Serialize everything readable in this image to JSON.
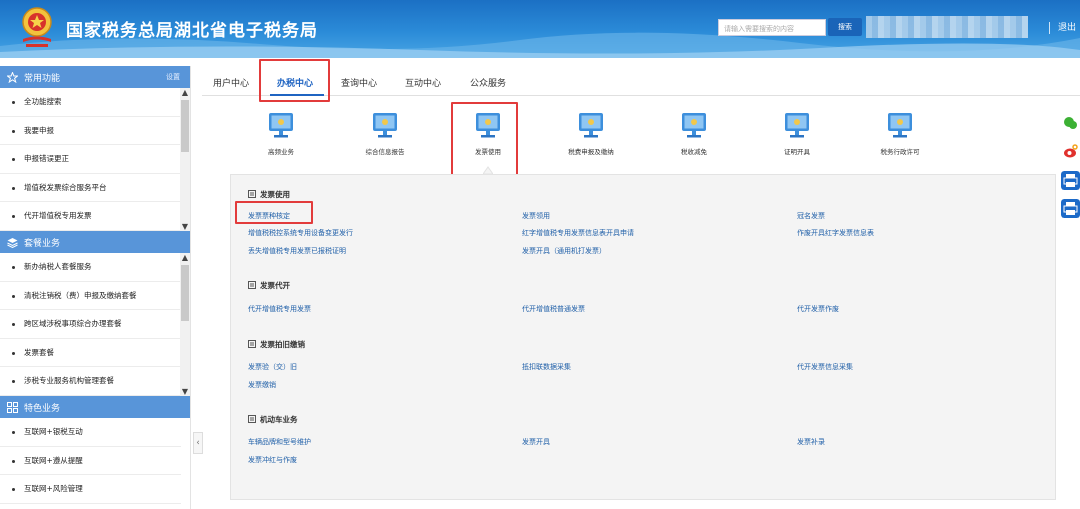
{
  "header": {
    "title": "国家税务总局湖北省电子税务局",
    "search_placeholder": "请输入需要搜索的内容",
    "search_button": "搜索",
    "logout": "退出"
  },
  "sidebar": {
    "sections": [
      {
        "title": "常用功能",
        "extra": "设置",
        "icon": "star-icon",
        "items": [
          "全功能搜索",
          "我要申报",
          "申报错误更正",
          "增值税发票综合服务平台",
          "代开增值税专用发票"
        ]
      },
      {
        "title": "套餐业务",
        "icon": "layers-icon",
        "items": [
          "新办纳税人套餐服务",
          "清税注销税（费）申报及缴纳套餐",
          "跨区域涉税事项综合办理套餐",
          "发票套餐",
          "涉税专业服务机构管理套餐"
        ]
      },
      {
        "title": "特色业务",
        "icon": "grid-icon",
        "items": [
          "互联网+银税互动",
          "互联网+遵从提醒",
          "互联网+风险管理"
        ]
      }
    ]
  },
  "tabs": [
    "用户中心",
    "办税中心",
    "查询中心",
    "互动中心",
    "公众服务"
  ],
  "active_tab": "办税中心",
  "functions": [
    "高频业务",
    "综合信息报告",
    "发票使用",
    "税费申报及缴纳",
    "税收减免",
    "证明开具",
    "税务行政许可"
  ],
  "active_function": "发票使用",
  "categories": [
    {
      "title": "发票使用",
      "links": [
        "发票票种核定",
        "发票领用",
        "冠名发票",
        "增值税税控系统专用设备变更发行",
        "红字增值税专用发票信息表开具申请",
        "作废开具红字发票信息表",
        "丢失增值税专用发票已报税证明",
        "发票开具（通用机打发票）"
      ]
    },
    {
      "title": "发票代开",
      "links": [
        "代开增值税专用发票",
        "代开增值税普通发票",
        "代开发票作废"
      ]
    },
    {
      "title": "发票拍旧缴销",
      "links": [
        "发票验（交）旧",
        "抵扣联数据采集",
        "代开发票信息采集",
        "发票缴销"
      ]
    },
    {
      "title": "机动车业务",
      "links": [
        "车辆品牌和型号维护",
        "发票开具",
        "发票补录",
        "发票冲红与作废"
      ]
    }
  ],
  "highlight_color": "#e23b3b",
  "accent_color": "#1f64c2"
}
